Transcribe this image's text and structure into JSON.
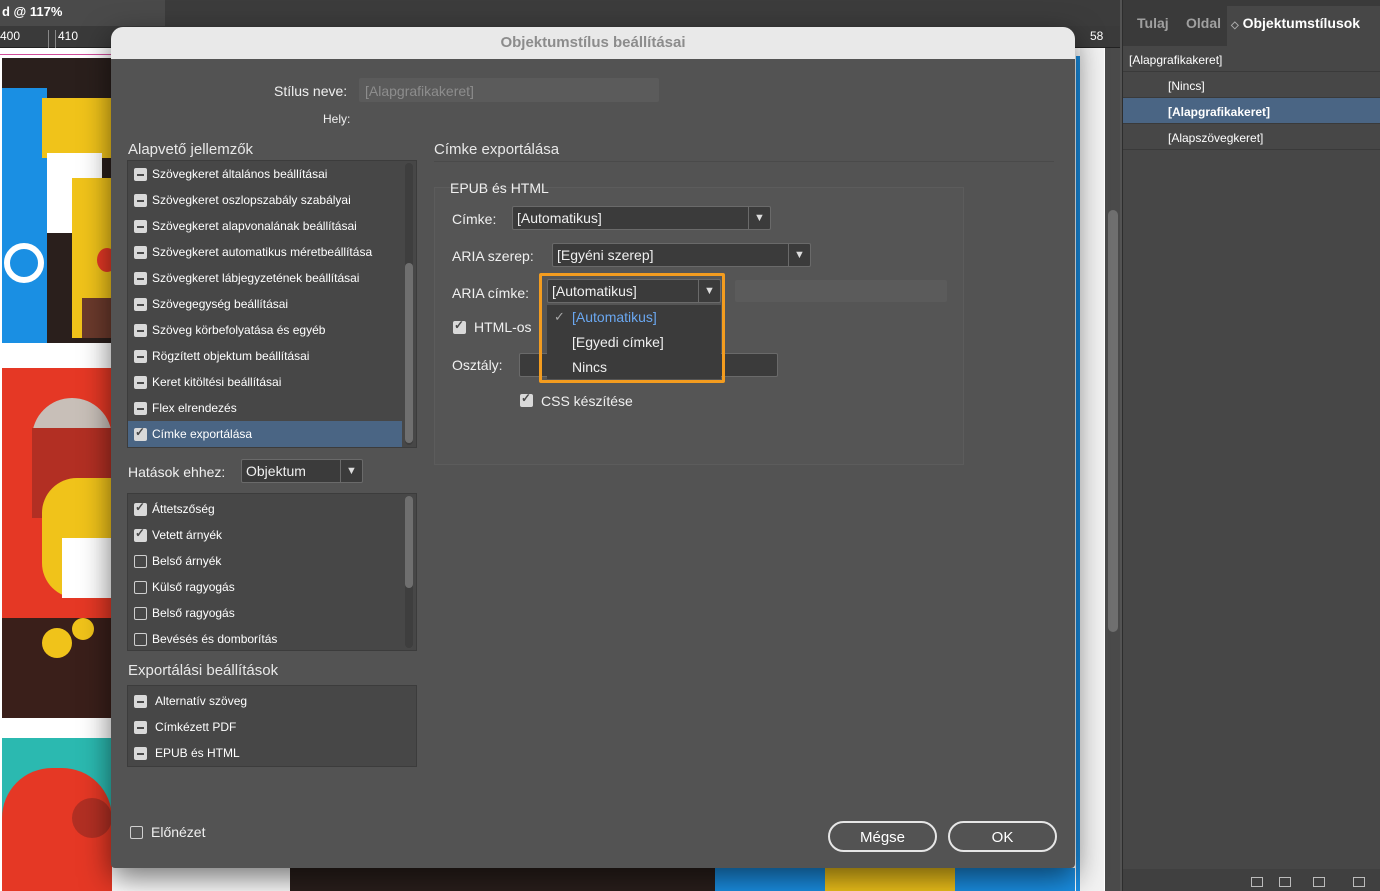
{
  "document": {
    "tab_title": "d @ 117%",
    "ruler_ticks": [
      "400",
      "410"
    ],
    "ruler_tick_right": "58"
  },
  "panel": {
    "tabs": [
      "Tulaj",
      "Oldal",
      "Objektumstílusok"
    ],
    "items": [
      "[Alapgrafikakeret]",
      "[Nincs]",
      "[Alapgrafikakeret]",
      "[Alapszövegkeret]"
    ]
  },
  "dialog": {
    "title": "Objektumstílus beállításai",
    "style_name_label": "Stílus neve:",
    "style_name_value": "[Alapgrafikakeret]",
    "location_label": "Hely:",
    "basic_section": "Alapvető jellemzők",
    "basic_items": [
      "Szövegkeret általános beállításai",
      "Szövegkeret oszlopszabály szabályai",
      "Szövegkeret alapvonalának beállításai",
      "Szövegkeret automatikus méretbeállítása",
      "Szövegkeret lábjegyzetének beállításai",
      "Szövegegység beállításai",
      "Szöveg körbefolyatása és egyéb",
      "Rögzített objektum beállításai",
      "Keret kitöltési beállításai",
      "Flex elrendezés",
      "Címke exportálása"
    ],
    "effects_label": "Hatások ehhez:",
    "effects_target": "Objektum",
    "effects_items": [
      "Áttetszőség",
      "Vetett árnyék",
      "Belső árnyék",
      "Külső ragyogás",
      "Belső ragyogás",
      "Bevésés és domborítás"
    ],
    "export_section": "Exportálási beállítások",
    "export_items": [
      "Alternatív szöveg",
      "Címkézett PDF",
      "EPUB és HTML"
    ],
    "preview_label": "Előnézet",
    "cancel_label": "Mégse",
    "ok_label": "OK"
  },
  "tag_export": {
    "heading": "Címke exportálása",
    "group_title": "EPUB és HTML",
    "tag_label": "Címke:",
    "tag_value": "[Automatikus]",
    "aria_role_label": "ARIA szerep:",
    "aria_role_value": "[Egyéni szerep]",
    "aria_label_label": "ARIA címke:",
    "aria_label_value": "[Automatikus]",
    "html_checkbox_label": "HTML-os",
    "class_label": "Osztály:",
    "css_label": "CSS készítése",
    "dropdown_options": [
      "[Automatikus]",
      "[Egyedi címke]",
      "Nincs"
    ],
    "dropdown_selected": "[Automatikus]"
  },
  "colors": {
    "accent_highlight": "#f39c1f",
    "selection": "#4a6584",
    "checked_option": "#6aa7f0"
  }
}
